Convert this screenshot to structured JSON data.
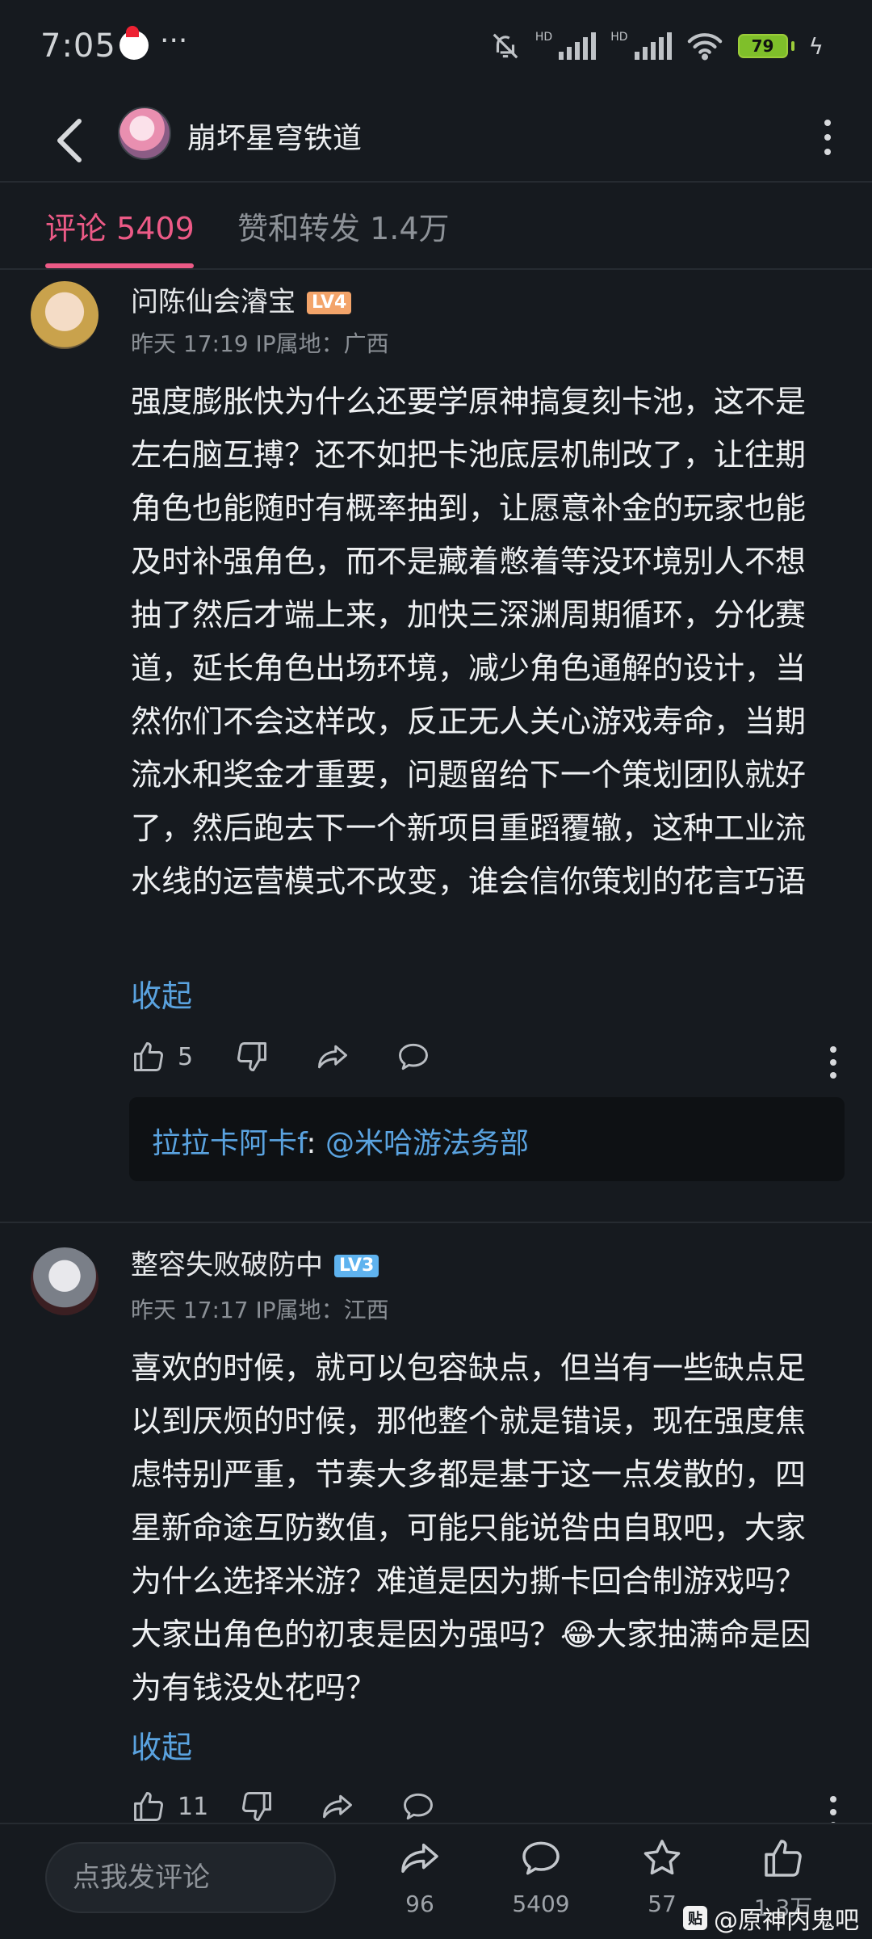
{
  "status_bar": {
    "time": "7:05",
    "dots": "···",
    "battery": "79"
  },
  "header": {
    "title": "崩坏星穹铁道"
  },
  "tabs": [
    {
      "label": "评论 5409"
    },
    {
      "label": "赞和转发 1.4万"
    }
  ],
  "comments": [
    {
      "username": "问陈仙会濬宝",
      "level": "LV4",
      "meta": "昨天 17:19 IP属地：广西",
      "body": "强度膨胀快为什么还要学原神搞复刻卡池，这不是左右脑互搏？还不如把卡池底层机制改了，让往期角色也能随时有概率抽到，让愿意补金的玩家也能及时补强角色，而不是藏着憋着等没环境别人不想抽了然后才端上来，加快三深渊周期循环，分化赛道，延长角色出场环境，减少角色通解的设计，当然你们不会这样改，反正无人关心游戏寿命，当期流水和奖金才重要，问题留给下一个策划团队就好了，然后跑去下一个新项目重蹈覆辙，这种工业流水线的运营模式不改变，谁会信你策划的花言巧语",
      "collapse": "收起",
      "likes": "5",
      "reply": {
        "name": "拉拉卡阿卡f",
        "colon": ": ",
        "mention": "@米哈游法务部"
      }
    },
    {
      "username": "整容失败破防中",
      "level": "LV3",
      "meta": "昨天 17:17 IP属地：江西",
      "body": "喜欢的时候，就可以包容缺点，但当有一些缺点足以到厌烦的时候，那他整个就是错误，现在强度焦虑特别严重，节奏大多都是基于这一点发散的，四星新命途互防数值，可能只能说咎由自取吧，大家为什么选择米游？难道是因为撕卡回合制游戏吗？大家出角色的初衷是因为强吗？😂大家抽满命是因为有钱没处花吗？",
      "collapse": "收起",
      "likes": "11"
    }
  ],
  "bottom_bar": {
    "input_placeholder": "点我发评论",
    "share_count": "96",
    "comment_count": "5409",
    "star_count": "57",
    "like_count": "1.3万"
  },
  "watermark": {
    "badge": "贴",
    "text": "@原神内鬼吧"
  },
  "colors": {
    "accent": "#ec5a86",
    "link": "#5aa3e0",
    "background": "#161a1f"
  }
}
